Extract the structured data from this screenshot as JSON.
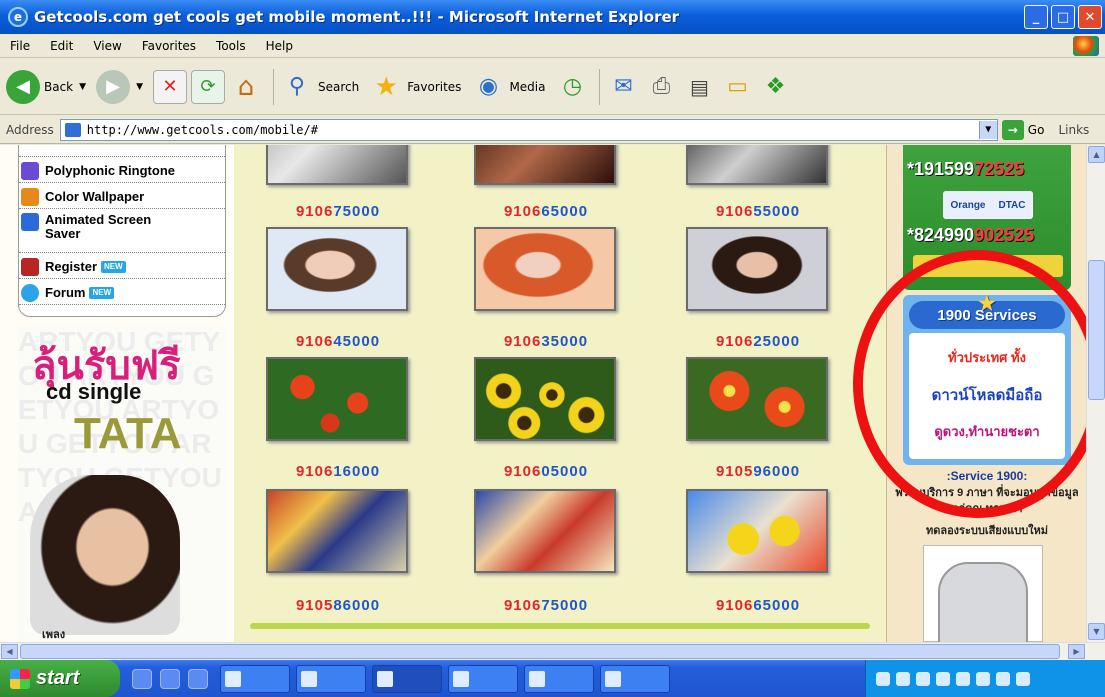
{
  "window": {
    "title": "Getcools.com get cools get mobile moment..!!! - Microsoft Internet Explorer"
  },
  "menu": [
    "File",
    "Edit",
    "View",
    "Favorites",
    "Tools",
    "Help"
  ],
  "toolbar": {
    "back": "Back",
    "search": "Search",
    "favorites": "Favorites",
    "media": "Media"
  },
  "address": {
    "label": "Address",
    "url": "http://www.getcools.com/mobile/#",
    "go": "Go",
    "links": "Links"
  },
  "sidebar": {
    "items": [
      {
        "label": "Polyphonic Ringtone",
        "color": "#6b4bd6"
      },
      {
        "label": "Color Wallpaper",
        "color": "#e58a1a"
      },
      {
        "label": "Animated Screen Saver",
        "color": "#2a6bd8"
      },
      {
        "label": "Register",
        "badge": "NEW",
        "color": "#b82525"
      },
      {
        "label": "Forum",
        "badge": "NEW",
        "color": "#2aa4e8"
      }
    ]
  },
  "promo": {
    "line1": "ลุ้นรับฟรี",
    "line2": "cd single",
    "line3": "TATA",
    "small": "เพลง"
  },
  "gallery": {
    "codes": [
      {
        "r": "9106",
        "b": "75000"
      },
      {
        "r": "9106",
        "b": "65000"
      },
      {
        "r": "9106",
        "b": "55000"
      },
      {
        "r": "9106",
        "b": "45000"
      },
      {
        "r": "9106",
        "b": "35000"
      },
      {
        "r": "9106",
        "b": "25000"
      },
      {
        "r": "9106",
        "b": "16000"
      },
      {
        "r": "9106",
        "b": "05000"
      },
      {
        "r": "9105",
        "b": "96000"
      },
      {
        "r": "9105",
        "b": "86000"
      },
      {
        "r": "9106",
        "b": "75000"
      },
      {
        "r": "9106",
        "b": "65000"
      }
    ]
  },
  "right": {
    "phone1": {
      "black": "*191599",
      "red": "72525"
    },
    "phone2": {
      "black": "*824990",
      "red": "902525"
    },
    "logos": [
      "Orange",
      "DTAC"
    ],
    "service_title": "1900 Services",
    "service_lines": [
      "ทั่วประเทศ ทั้ง",
      "ดาวน์โหลดมือถือ",
      "ดูดวง,ทำนายชะตา"
    ],
    "service_sub": ":Service 1900:",
    "service_thai": "พร้อมบริการ 9 ภาษา ที่จะมอบทุกข้อมูลแก่คุณ ทุกเวลา",
    "service_thai2": "ทดลองระบบเสียงแบบใหม่"
  },
  "taskbar": {
    "start": "start"
  },
  "colors": {
    "titlebar": "#0a5fd8",
    "highlight_circle": "#ee1111",
    "gallery_bg": "#f2f2c6"
  }
}
